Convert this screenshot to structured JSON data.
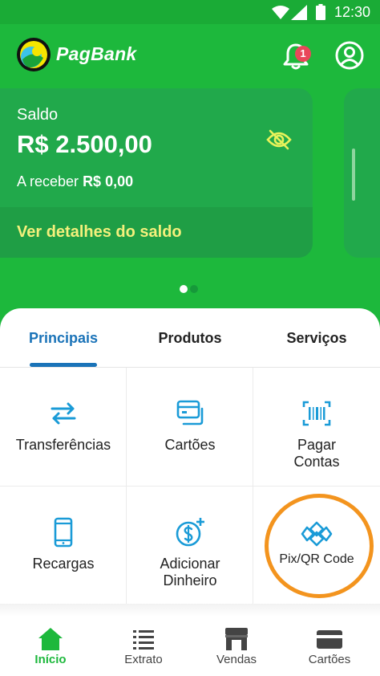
{
  "status_bar": {
    "time": "12:30"
  },
  "header": {
    "brand": "PagBank",
    "notification_count": "1"
  },
  "balance": {
    "label": "Saldo",
    "amount": "R$ 2.500,00",
    "receber_label": "A receber",
    "receber_value": "R$ 0,00",
    "details_link": "Ver detalhes do saldo"
  },
  "tabs": [
    {
      "label": "Principais",
      "active": true
    },
    {
      "label": "Produtos",
      "active": false
    },
    {
      "label": "Serviços",
      "active": false
    }
  ],
  "actions": [
    {
      "label": "Transferências",
      "icon": "transfer-icon"
    },
    {
      "label": "Cartões",
      "icon": "cards-icon"
    },
    {
      "label_line1": "Pagar",
      "label_line2": "Contas",
      "icon": "barcode-icon"
    },
    {
      "label": "Recargas",
      "icon": "phone-icon"
    },
    {
      "label_line1": "Adicionar",
      "label_line2": "Dinheiro",
      "icon": "add-money-icon"
    },
    {
      "label": "Pix/QR Code",
      "icon": "pix-icon"
    }
  ],
  "bottom_nav": [
    {
      "label": "Início",
      "icon": "home-icon",
      "active": true
    },
    {
      "label": "Extrato",
      "icon": "list-icon",
      "active": false
    },
    {
      "label": "Vendas",
      "icon": "store-icon",
      "active": false
    },
    {
      "label": "Cartões",
      "icon": "card-icon",
      "active": false
    }
  ],
  "colors": {
    "primary_green": "#1db83c",
    "accent_blue": "#1a73b8",
    "link_yellow": "#f4f07c",
    "highlight_orange": "#f3941e",
    "badge_red": "#e9475a"
  }
}
